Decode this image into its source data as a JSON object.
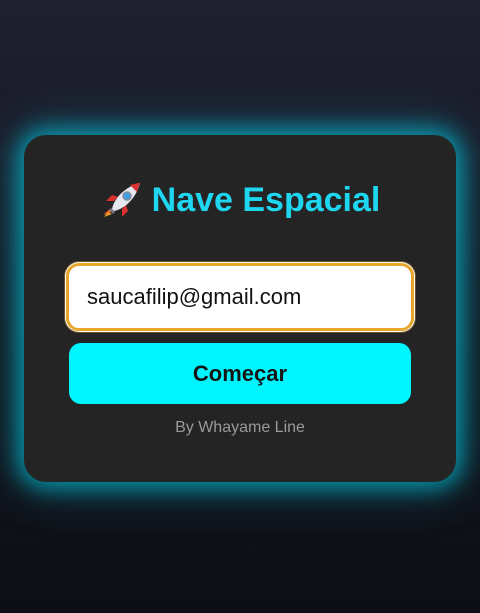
{
  "app": {
    "title": "Nave Espacial",
    "title_icon": "rocket-icon",
    "accent_color": "#1ed6f0",
    "button_color": "#00f6ff",
    "focus_border_color": "#e8a52c"
  },
  "form": {
    "email_value": "saucafilip@gmail.com",
    "start_label": "Começar"
  },
  "footer": {
    "credit": "By Whayame Line"
  }
}
